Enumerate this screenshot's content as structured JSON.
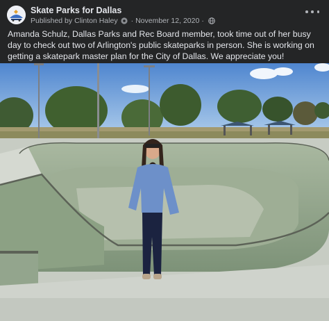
{
  "post": {
    "page_name": "Skate Parks for Dallas",
    "published_prefix": "Published by",
    "publisher": "Clinton Haley",
    "date": "November 12, 2020",
    "separator": "·",
    "text": "Amanda Schulz, Dallas Parks and Rec Board member, took time out of her busy day to check out two of Arlington's public skateparks in person. She is working on getting a skatepark master plan for the City of Dallas. We appreciate you!"
  },
  "icons": {
    "avatar": "skate-park-logo",
    "publisher_settings": "gear-icon",
    "audience": "globe-icon",
    "more": "more-options-icon"
  },
  "colors": {
    "background": "#242526",
    "primary_text": "#e4e6eb",
    "secondary_text": "#b0b3b8"
  }
}
